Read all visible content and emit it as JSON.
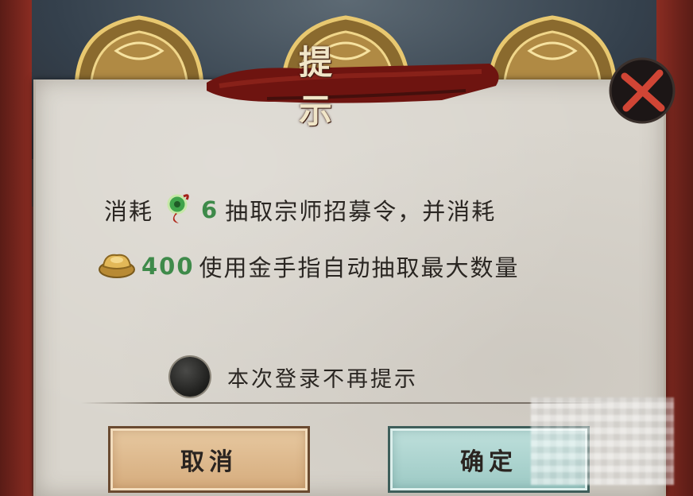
{
  "dialog": {
    "title": "提 示",
    "message_line1": {
      "prefix": "消耗",
      "item_icon": "green-jade-token-icon",
      "count": "6",
      "suffix": "抽取宗师招募令，并消耗"
    },
    "message_line2": {
      "currency_icon": "gold-ingot-icon",
      "count": "400",
      "suffix": "使用金手指自动抽取最大数量"
    },
    "option_label": "本次登录不再提示",
    "cancel_label": "取消",
    "confirm_label": "确定"
  },
  "colors": {
    "accent_number": "#3e8a4a",
    "panel": "#d9d5cd",
    "cancel_button": "#e1bd92",
    "confirm_button": "#a9d2cd",
    "close_x": "#c0392b"
  }
}
